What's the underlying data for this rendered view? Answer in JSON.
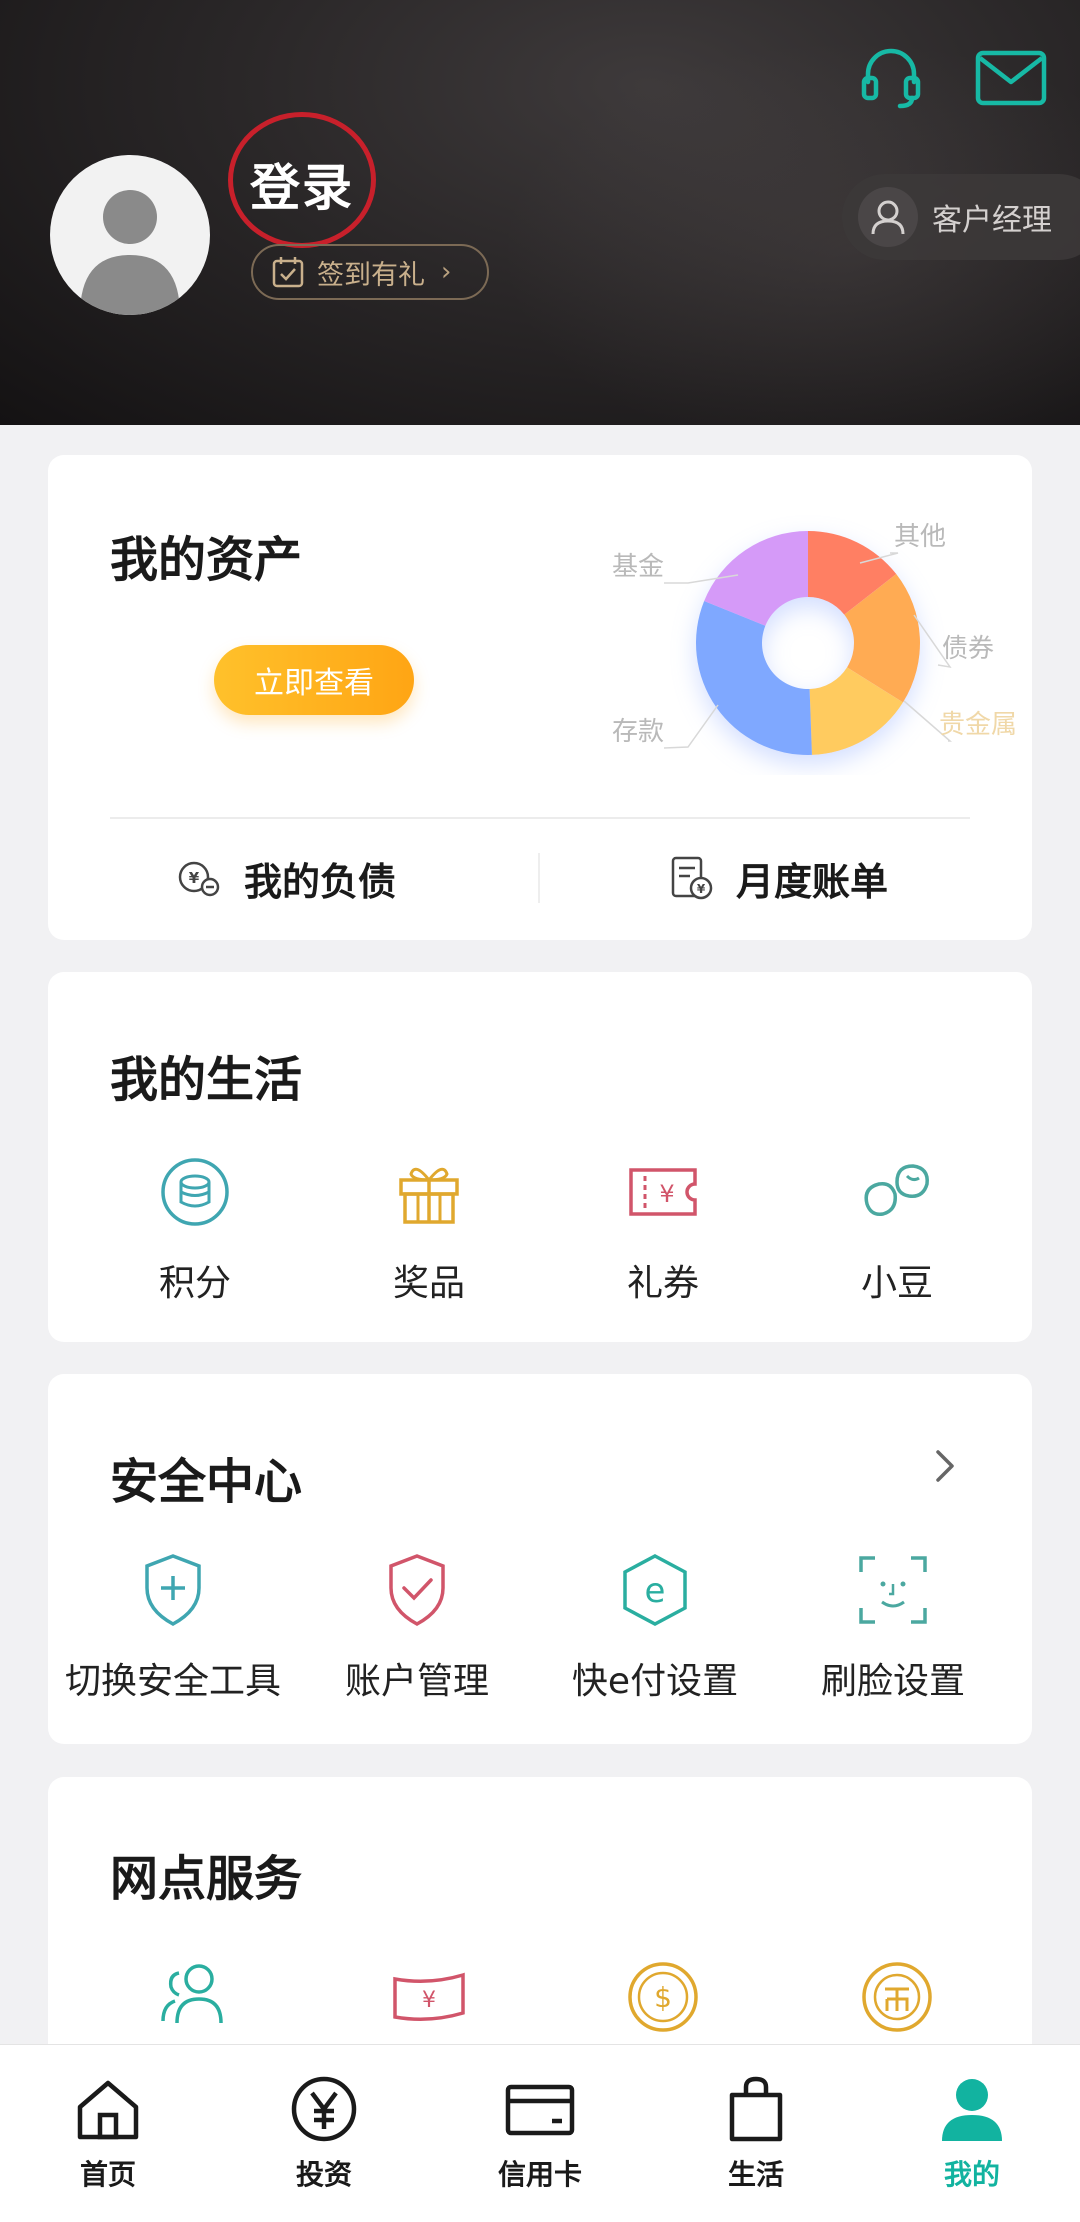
{
  "header": {
    "login_label": "登录",
    "signin_label": "签到有礼",
    "account_manager_label": "客户经理"
  },
  "assets": {
    "title": "我的资产",
    "view_button": "立即查看",
    "chart_segments": [
      {
        "label": "其他",
        "color": "#ff7f63"
      },
      {
        "label": "债券",
        "color": "#ffab52"
      },
      {
        "label": "贵金属",
        "color": "#ffcb5f"
      },
      {
        "label": "存款",
        "color": "#7fa8ff"
      },
      {
        "label": "基金",
        "color": "#d59af8"
      }
    ],
    "links": [
      {
        "label": "我的负债",
        "icon": "debt-coin-icon"
      },
      {
        "label": "月度账单",
        "icon": "monthly-bill-icon"
      }
    ]
  },
  "life": {
    "title": "我的生活",
    "items": [
      {
        "label": "积分",
        "icon": "points-coin-icon"
      },
      {
        "label": "奖品",
        "icon": "gift-icon"
      },
      {
        "label": "礼券",
        "icon": "coupon-icon"
      },
      {
        "label": "小豆",
        "icon": "beans-icon"
      }
    ]
  },
  "security": {
    "title": "安全中心",
    "items": [
      {
        "label": "切换安全工具",
        "icon": "switch-shield-icon"
      },
      {
        "label": "账户管理",
        "icon": "account-shield-icon"
      },
      {
        "label": "快e付设置",
        "icon": "e-pay-icon"
      },
      {
        "label": "刷脸设置",
        "icon": "face-scan-icon"
      }
    ]
  },
  "outlets": {
    "title": "网点服务",
    "items": [
      {
        "icon": "people-icon"
      },
      {
        "icon": "banknote-icon"
      },
      {
        "icon": "dollar-coin-icon"
      },
      {
        "icon": "currency-coin-icon"
      }
    ]
  },
  "tabs": [
    {
      "label": "首页",
      "icon": "home-icon"
    },
    {
      "label": "投资",
      "icon": "yen-circle-icon"
    },
    {
      "label": "信用卡",
      "icon": "credit-card-icon"
    },
    {
      "label": "生活",
      "icon": "shopping-bag-icon"
    },
    {
      "label": "我的",
      "icon": "person-icon",
      "active": true
    }
  ],
  "colors": {
    "accent": "#12b3a0",
    "login_ring": "#c8202b",
    "button_gradient_start": "#ffc12b",
    "button_gradient_end": "#ffa514"
  }
}
